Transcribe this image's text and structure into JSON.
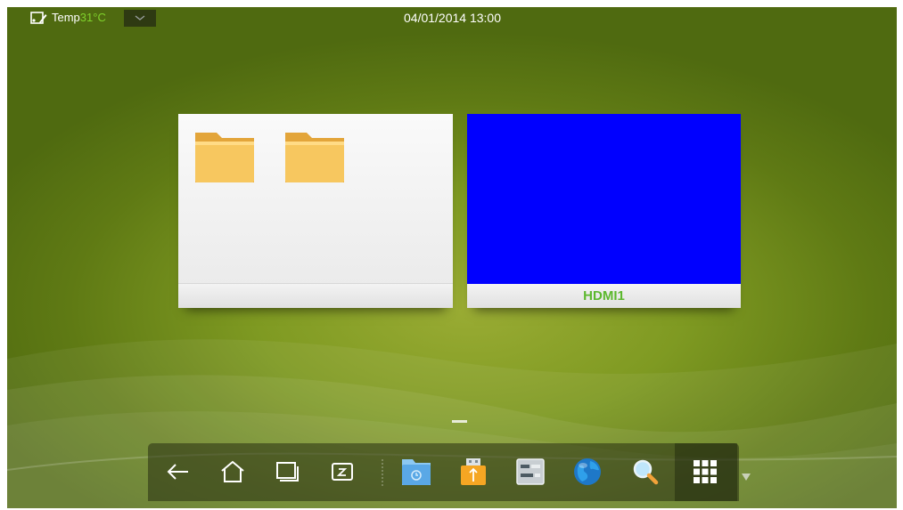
{
  "status_bar": {
    "temp_label": "Temp",
    "temp_value": "31°C",
    "datetime": "04/01/2014 13:00"
  },
  "cards": [
    {
      "name": "files",
      "label": ""
    },
    {
      "name": "hdmi",
      "label": "HDMI1",
      "preview_color": "#0000ff"
    }
  ],
  "dock": {
    "icons": [
      "back-arrow-icon",
      "home-icon",
      "recent-windows-icon",
      "whiteboard-icon",
      "folder-icon",
      "usb-drive-icon",
      "settings-panel-icon",
      "globe-icon",
      "magnifier-icon",
      "apps-grid-icon",
      "expand-down-icon"
    ]
  },
  "colors": {
    "accent_green": "#5cb82e",
    "temp_green": "#7fd12b"
  }
}
